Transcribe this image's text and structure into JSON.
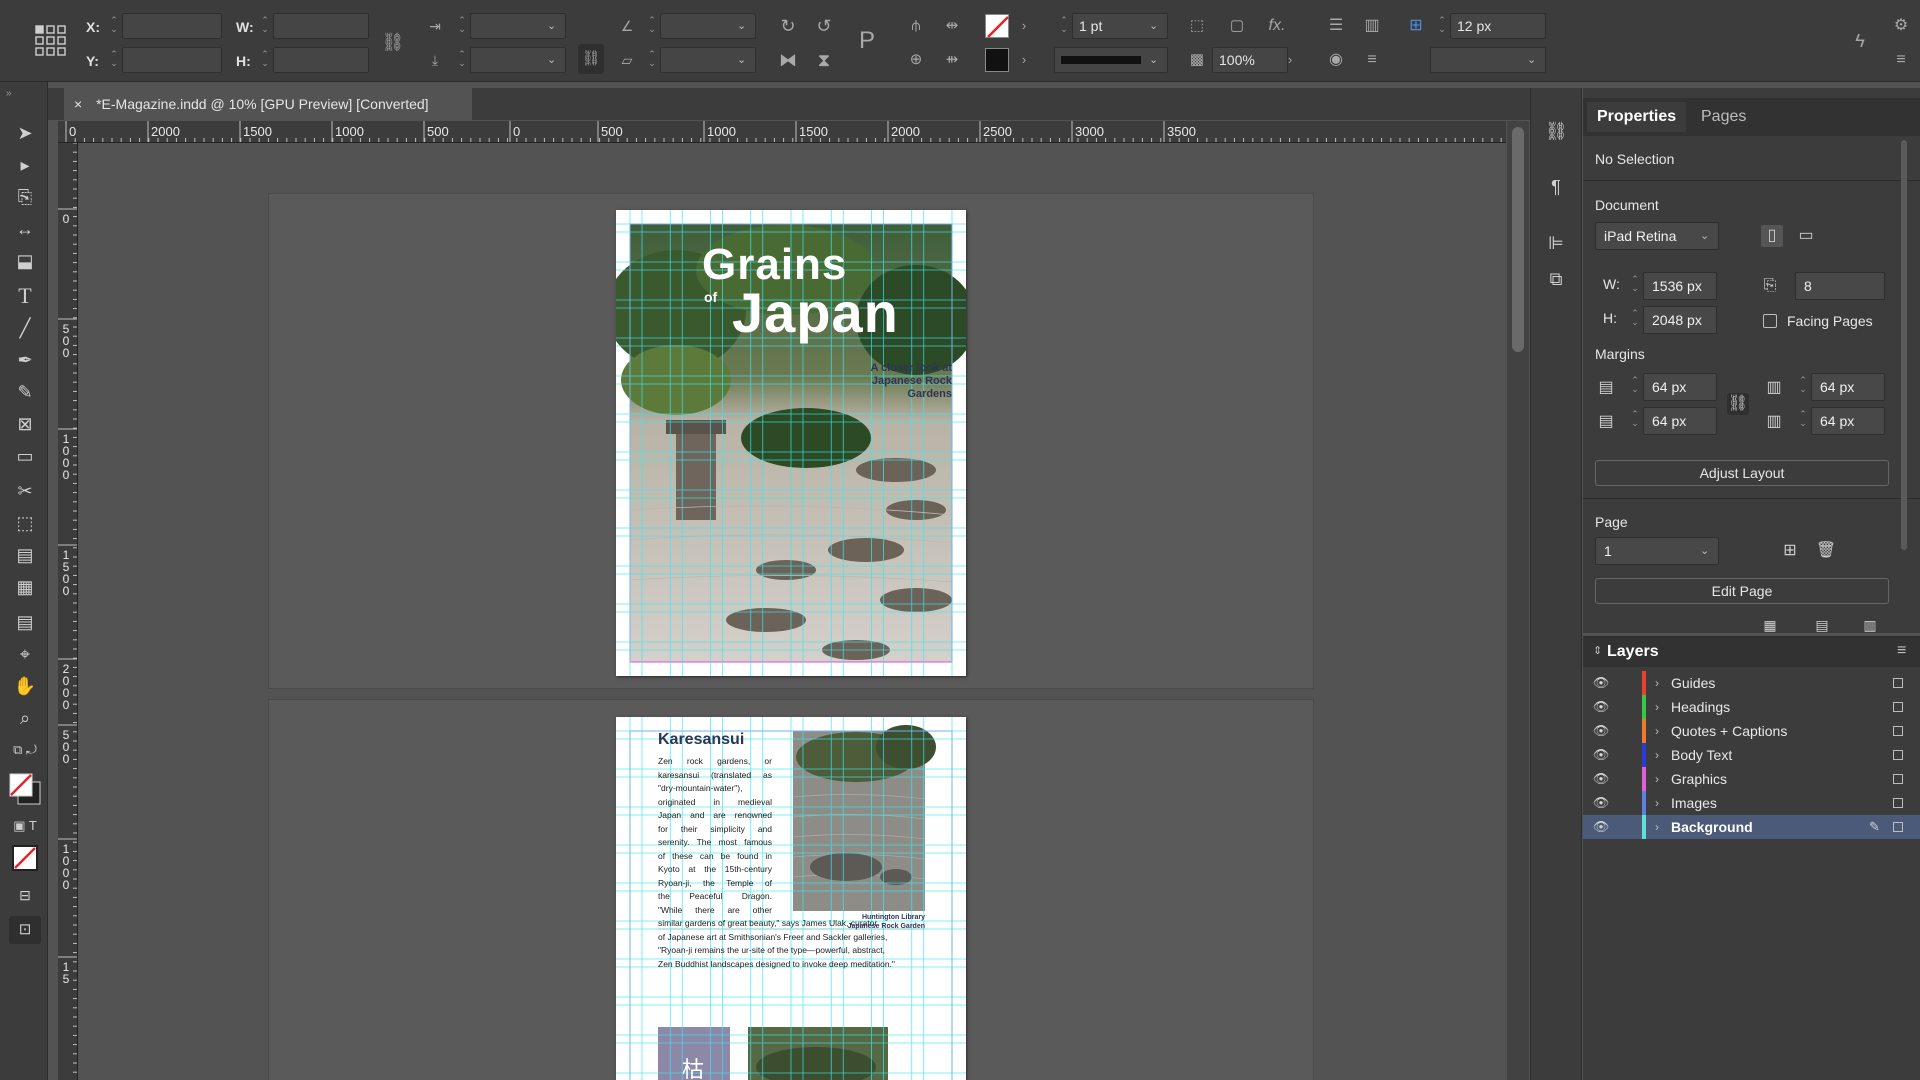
{
  "control_bar": {
    "x_label": "X:",
    "y_label": "Y:",
    "w_label": "W:",
    "h_label": "H:",
    "stroke_weight": "1 pt",
    "opacity": "100%",
    "gutter": "12 px",
    "fx_label": "fx."
  },
  "document_tab": {
    "title": "*E-Magazine.indd @ 10% [GPU Preview] [Converted]",
    "close_glyph": "×"
  },
  "ruler": {
    "h_labels": [
      "0",
      "2000",
      "1500",
      "1000",
      "500",
      "0",
      "500",
      "1000",
      "1500",
      "2000",
      "2500",
      "3000",
      "3500"
    ],
    "v_labels": [
      "0",
      "500",
      "1000",
      "1500",
      "2000",
      "500",
      "1000",
      "15"
    ]
  },
  "cover_page": {
    "title_line1": "Grains",
    "title_of": "of",
    "title_line2": "Japan",
    "subtitle_line1": "A closer look at",
    "subtitle_line2": "Japanese Rock",
    "subtitle_line3": "Gardens"
  },
  "article_page": {
    "heading": "Karesansui",
    "body_column": [
      "Zen rock gardens, or",
      "karesansui (translated as",
      "\"dry-mountain-water\"),",
      "originated in medieval",
      "Japan and are renowned",
      "for their simplicity and",
      "serenity. The most famous",
      "of these can be found in",
      "Kyoto at the 15th-century",
      "Ryoan-ji, the Temple of",
      "the Peaceful Dragon.",
      "\"While there are other"
    ],
    "body_full": [
      "similar gardens of great beauty,\" says James Ulak, curator",
      "of Japanese art at Smithsonian's Freer and Sackler galleries,",
      "\"Ryoan-ji remains the ur-site of the type—powerful, abstract,",
      "Zen Buddhist landscapes designed to invoke deep meditation.\""
    ],
    "caption_line1": "Huntington Library",
    "caption_line2": "Japanese Rock Garden",
    "kanji": "枯"
  },
  "properties_panel": {
    "tabs": [
      "Properties",
      "Pages"
    ],
    "selection": "No Selection",
    "document_heading": "Document",
    "preset": "iPad Retina",
    "w_label": "W:",
    "h_label": "H:",
    "width": "1536 px",
    "height": "2048 px",
    "pages": "8",
    "facing_pages_label": "Facing Pages",
    "facing_pages_checked": false,
    "margins_heading": "Margins",
    "margin_top": "64 px",
    "margin_bottom": "64 px",
    "margin_left": "64 px",
    "margin_right": "64 px",
    "adjust_layout": "Adjust Layout",
    "page_heading": "Page",
    "page_number": "1",
    "edit_page": "Edit Page"
  },
  "layers_panel": {
    "title": "Layers",
    "layers": [
      {
        "name": "Guides",
        "color": "#e8412f"
      },
      {
        "name": "Headings",
        "color": "#36c947"
      },
      {
        "name": "Quotes + Captions",
        "color": "#f07a2b"
      },
      {
        "name": "Body Text",
        "color": "#2b3bd8"
      },
      {
        "name": "Graphics",
        "color": "#e35fd3"
      },
      {
        "name": "Images",
        "color": "#5f7fe0"
      },
      {
        "name": "Background",
        "color": "#5fe0d3",
        "selected": true
      }
    ]
  },
  "colors": {
    "ui_dark": "#3c3c3c",
    "pasteboard": "#535353",
    "guide_cyan": "#38e8f0",
    "margin_magenta": "#d94fe0",
    "heading_navy": "#2c3558",
    "selected_layer": "#4a5a78"
  }
}
